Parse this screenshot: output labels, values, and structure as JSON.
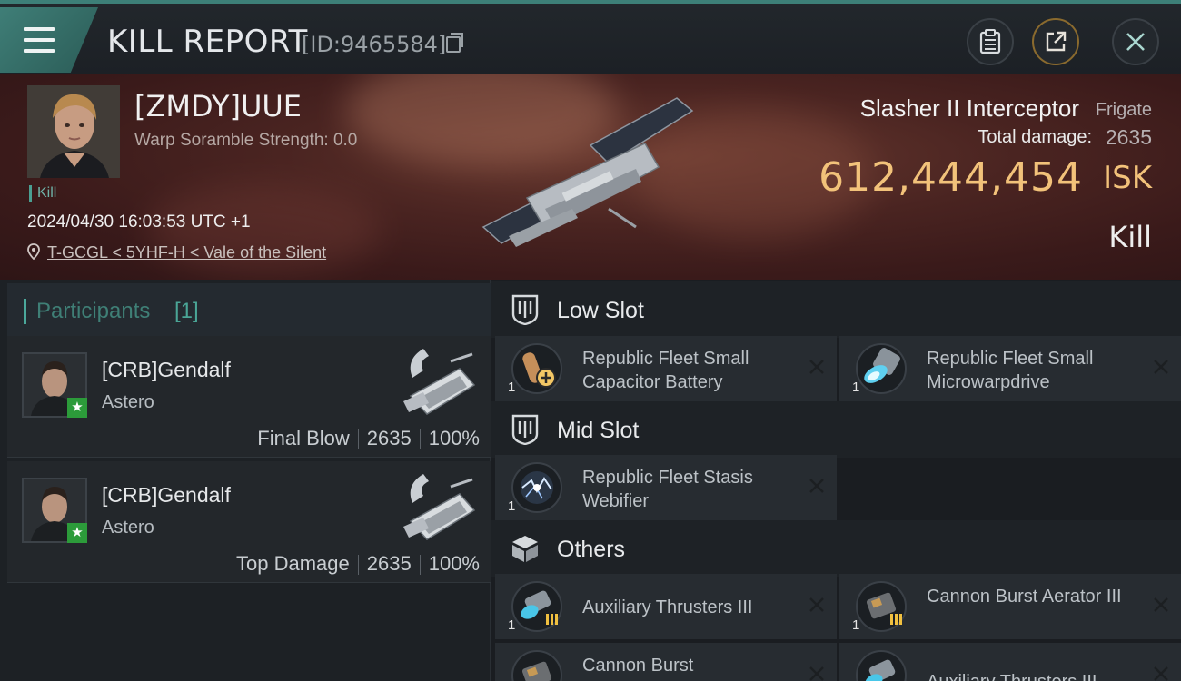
{
  "header": {
    "title": "KILL REPORT",
    "report_id": "[ID:9465584]"
  },
  "victim": {
    "name": "[ZMDY]UUE",
    "warp_scramble": "Warp Soramble Strength: 0.0",
    "tag": "Kill",
    "datetime": "2024/04/30 16:03:53 UTC +1",
    "location": "T-GCGL < 5YHF-H < Vale of the Silent",
    "ship_name": "Slasher II Interceptor",
    "ship_class": "Frigate",
    "total_damage_label": "Total damage:",
    "total_damage": "2635",
    "isk_value": "612,444,454",
    "isk_unit": "ISK",
    "result": "Kill"
  },
  "participants": {
    "title": "Participants",
    "count": "[1]",
    "rows": [
      {
        "name": "[CRB]Gendalf",
        "ship": "Astero",
        "role": "Final Blow",
        "damage": "2635",
        "percent": "100%"
      },
      {
        "name": "[CRB]Gendalf",
        "ship": "Astero",
        "role": "Top Damage",
        "damage": "2635",
        "percent": "100%"
      }
    ]
  },
  "fitting": {
    "low_slot": {
      "title": "Low Slot",
      "modules": [
        {
          "name": "Republic Fleet Small Capacitor Battery",
          "qty": "1"
        },
        {
          "name": "Republic Fleet Small Microwarpdrive",
          "qty": "1"
        }
      ]
    },
    "mid_slot": {
      "title": "Mid Slot",
      "modules": [
        {
          "name": "Republic Fleet Stasis Webifier",
          "qty": "1"
        }
      ]
    },
    "others": {
      "title": "Others",
      "modules": [
        {
          "name": "Auxiliary Thrusters III",
          "qty": "1"
        },
        {
          "name": "Cannon Burst Aerator III",
          "qty": "1"
        },
        {
          "name": "Cannon Burst",
          "qty": ""
        },
        {
          "name": "Auxiliary Thrusters III",
          "qty": ""
        }
      ]
    }
  },
  "colors": {
    "accent": "#3d7f78",
    "isk": "#f2c27a",
    "banner": "#4a2421"
  }
}
